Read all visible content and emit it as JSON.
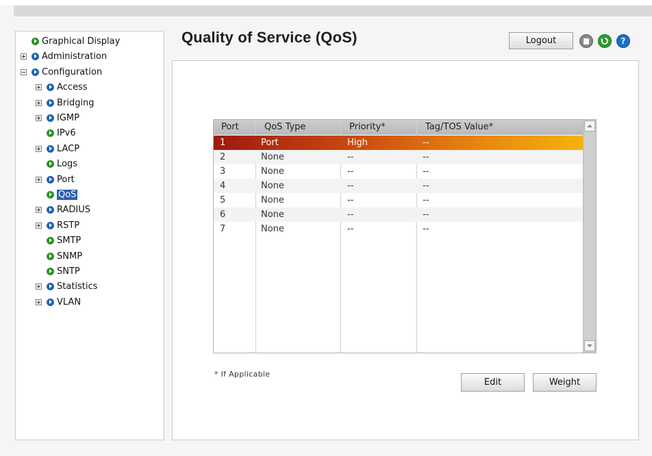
{
  "page": {
    "title": "Quality of Service (QoS)"
  },
  "header": {
    "logout_label": "Logout"
  },
  "toolbar_icons": [
    "save-icon",
    "refresh-icon",
    "help-icon"
  ],
  "colors": {
    "selected_nav": "#2c5fb3",
    "node_blue": "#1f63b4",
    "node_green": "#279424",
    "row_highlight_start": "#9c1a10",
    "row_highlight_end": "#f6b30a"
  },
  "nav": {
    "items": [
      {
        "label": "Graphical Display",
        "expander": "none",
        "icon": "green",
        "level": 0
      },
      {
        "label": "Administration",
        "expander": "plus",
        "icon": "blue",
        "level": 0
      },
      {
        "label": "Configuration",
        "expander": "minus",
        "icon": "blue",
        "level": 0
      },
      {
        "label": "Access",
        "expander": "plus",
        "icon": "blue",
        "level": 1
      },
      {
        "label": "Bridging",
        "expander": "plus",
        "icon": "blue",
        "level": 1
      },
      {
        "label": "IGMP",
        "expander": "plus",
        "icon": "blue",
        "level": 1
      },
      {
        "label": "IPv6",
        "expander": "none",
        "icon": "green",
        "level": 1
      },
      {
        "label": "LACP",
        "expander": "plus",
        "icon": "blue",
        "level": 1
      },
      {
        "label": "Logs",
        "expander": "none",
        "icon": "green",
        "level": 1
      },
      {
        "label": "Port",
        "expander": "plus",
        "icon": "blue",
        "level": 1
      },
      {
        "label": "QoS",
        "expander": "none",
        "icon": "green",
        "level": 1,
        "selected": true
      },
      {
        "label": "RADIUS",
        "expander": "plus",
        "icon": "blue",
        "level": 1
      },
      {
        "label": "RSTP",
        "expander": "plus",
        "icon": "blue",
        "level": 1
      },
      {
        "label": "SMTP",
        "expander": "none",
        "icon": "green",
        "level": 1
      },
      {
        "label": "SNMP",
        "expander": "none",
        "icon": "green",
        "level": 1
      },
      {
        "label": "SNTP",
        "expander": "none",
        "icon": "green",
        "level": 1
      },
      {
        "label": "Statistics",
        "expander": "plus",
        "icon": "blue",
        "level": 1
      },
      {
        "label": "VLAN",
        "expander": "plus",
        "icon": "blue",
        "level": 1
      }
    ]
  },
  "table": {
    "columns": [
      "Port",
      "QoS Type",
      "Priority*",
      "Tag/TOS Value*"
    ],
    "rows": [
      [
        "1",
        "Port",
        "High",
        "--"
      ],
      [
        "2",
        "None",
        "--",
        "--"
      ],
      [
        "3",
        "None",
        "--",
        "--"
      ],
      [
        "4",
        "None",
        "--",
        "--"
      ],
      [
        "5",
        "None",
        "--",
        "--"
      ],
      [
        "6",
        "None",
        "--",
        "--"
      ],
      [
        "7",
        "None",
        "--",
        "--"
      ]
    ],
    "selected_row": 0
  },
  "footnote": "* If Applicable",
  "buttons": {
    "edit_label": "Edit",
    "weight_label": "Weight"
  }
}
